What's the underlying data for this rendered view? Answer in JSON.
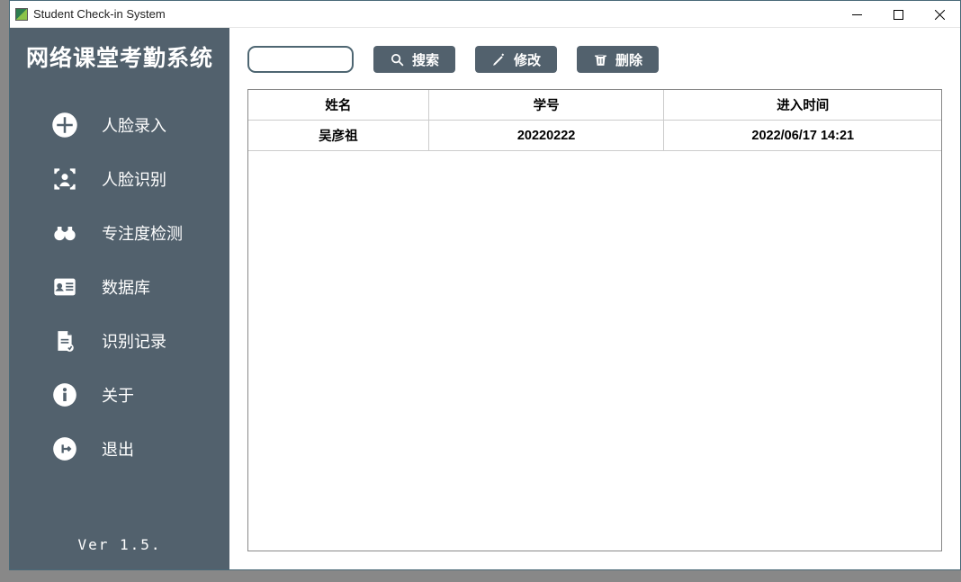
{
  "window": {
    "title": "Student Check-in System"
  },
  "sidebar": {
    "system_title": "网络课堂考勤系统",
    "items": [
      {
        "label": "人脸录入"
      },
      {
        "label": "人脸识别"
      },
      {
        "label": "专注度检测"
      },
      {
        "label": "数据库"
      },
      {
        "label": "识别记录"
      },
      {
        "label": "关于"
      },
      {
        "label": "退出"
      }
    ],
    "version": "Ver 1.5."
  },
  "toolbar": {
    "search_value": "",
    "search_label": "搜索",
    "edit_label": "修改",
    "delete_label": "删除"
  },
  "table": {
    "headers": [
      "姓名",
      "学号",
      "进入时间"
    ],
    "rows": [
      {
        "name": "吴彦祖",
        "id": "20220222",
        "time": "2022/06/17 14:21"
      }
    ]
  }
}
